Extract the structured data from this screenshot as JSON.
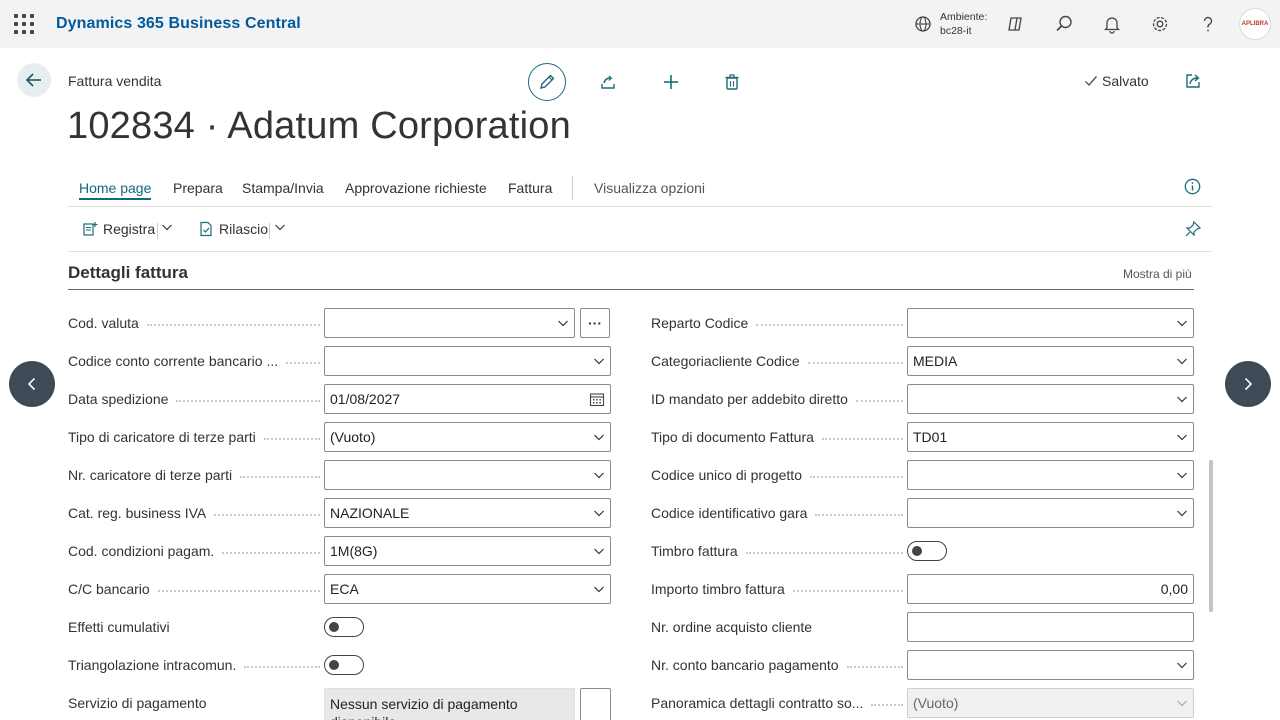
{
  "topbar": {
    "app_name": "Dynamics 365 Business Central",
    "env_label": "Ambiente:",
    "env_value": "bc28-it",
    "avatar_text": "APLIBRA"
  },
  "header": {
    "breadcrumb": "Fattura vendita",
    "saved_label": "Salvato",
    "title": "102834 · Adatum Corporation"
  },
  "tabs": [
    {
      "label": "Home page"
    },
    {
      "label": "Prepara"
    },
    {
      "label": "Stampa/Invia"
    },
    {
      "label": "Approvazione richieste"
    },
    {
      "label": "Fattura"
    },
    {
      "label": "Visualizza opzioni"
    }
  ],
  "toolbar": {
    "registra_label": "Registra",
    "rilascio_label": "Rilascio"
  },
  "section": {
    "title": "Dettagli fattura",
    "show_more": "Mostra di più"
  },
  "left_fields": [
    {
      "label": "Cod. valuta",
      "value": ""
    },
    {
      "label": "Codice conto corrente bancario ...",
      "value": ""
    },
    {
      "label": "Data spedizione",
      "value": "01/08/2027"
    },
    {
      "label": "Tipo di caricatore di terze parti",
      "value": "(Vuoto)"
    },
    {
      "label": "Nr. caricatore di terze parti",
      "value": ""
    },
    {
      "label": "Cat. reg. business IVA",
      "value": "NAZIONALE"
    },
    {
      "label": "Cod. condizioni pagam.",
      "value": "1M(8G)"
    },
    {
      "label": "C/C bancario",
      "value": "ECA"
    },
    {
      "label": "Effetti cumulativi",
      "value": ""
    },
    {
      "label": "Triangolazione intracomun.",
      "value": ""
    },
    {
      "label": "Servizio di pagamento",
      "value": "Nessun servizio di pagamento disponibile"
    }
  ],
  "right_fields": [
    {
      "label": "Reparto Codice",
      "value": ""
    },
    {
      "label": "Categoriacliente Codice",
      "value": "MEDIA"
    },
    {
      "label": "ID mandato per addebito diretto",
      "value": ""
    },
    {
      "label": "Tipo di documento Fattura",
      "value": "TD01"
    },
    {
      "label": "Codice unico di progetto",
      "value": ""
    },
    {
      "label": "Codice identificativo gara",
      "value": ""
    },
    {
      "label": "Timbro fattura",
      "value": ""
    },
    {
      "label": "Importo timbro fattura",
      "value": "0,00"
    },
    {
      "label": "Nr. ordine acquisto cliente",
      "value": ""
    },
    {
      "label": "Nr. conto bancario pagamento",
      "value": ""
    },
    {
      "label": "Panoramica dettagli contratto so...",
      "value": "(Vuoto)"
    }
  ],
  "toggles": {
    "effetti_cumulativi": false,
    "triangolazione": false,
    "timbro_fattura": false
  },
  "colors": {
    "brand": "#005a9e",
    "accent": "#0f6b78",
    "nav_circle": "#3d4a58"
  }
}
